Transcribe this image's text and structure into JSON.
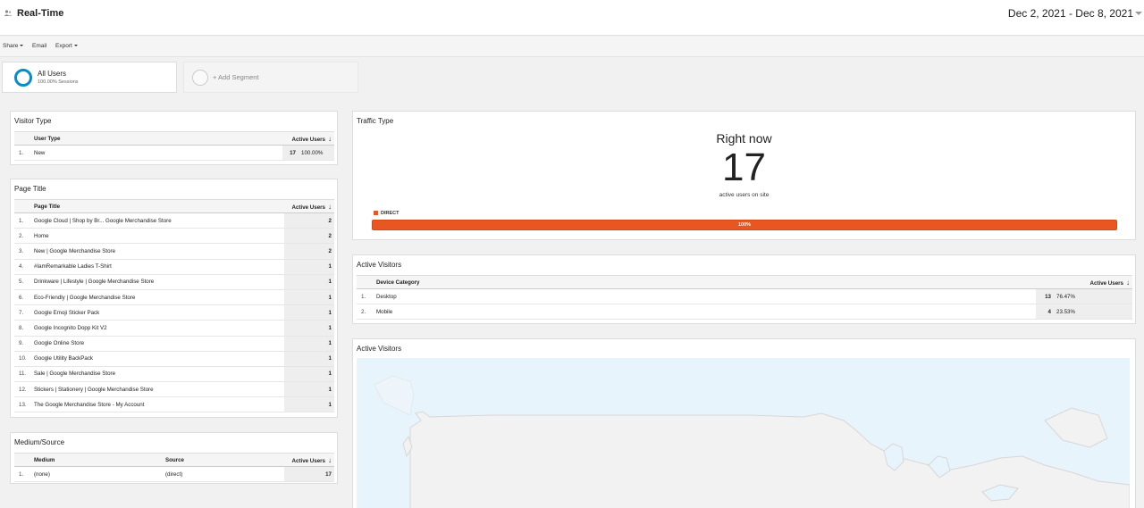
{
  "header": {
    "title": "Real-Time",
    "date_range": "Dec 2, 2021 - Dec 8, 2021"
  },
  "toolbar": {
    "share": "Share",
    "email": "Email",
    "export": "Export"
  },
  "segments": {
    "active": {
      "name": "All Users",
      "sub": "100.00% Sessions"
    },
    "add_label": "+ Add Segment"
  },
  "visitor_type": {
    "title": "Visitor Type",
    "columns": [
      "User Type",
      "Active Users"
    ],
    "rows": [
      {
        "idx": "1.",
        "label": "New",
        "value": "17",
        "pct": "100.00%"
      }
    ]
  },
  "page_title": {
    "title": "Page Title",
    "columns": [
      "Page Title",
      "Active Users"
    ],
    "rows": [
      {
        "idx": "1.",
        "label": "Google Cloud | Shop by Br... Google Merchandise Store",
        "value": "2"
      },
      {
        "idx": "2.",
        "label": "Home",
        "value": "2"
      },
      {
        "idx": "3.",
        "label": "New | Google Merchandise Store",
        "value": "2"
      },
      {
        "idx": "4.",
        "label": "#IamRemarkable Ladies T-Shirt",
        "value": "1"
      },
      {
        "idx": "5.",
        "label": "Drinkware | Lifestyle | Google Merchandise Store",
        "value": "1"
      },
      {
        "idx": "6.",
        "label": "Eco-Friendly | Google Merchandise Store",
        "value": "1"
      },
      {
        "idx": "7.",
        "label": "Google Emoji Sticker Pack",
        "value": "1"
      },
      {
        "idx": "8.",
        "label": "Google Incognito Dopp Kit V2",
        "value": "1"
      },
      {
        "idx": "9.",
        "label": "Google Online Store",
        "value": "1"
      },
      {
        "idx": "10.",
        "label": "Google Utility BackPack",
        "value": "1"
      },
      {
        "idx": "11.",
        "label": "Sale | Google Merchandise Store",
        "value": "1"
      },
      {
        "idx": "12.",
        "label": "Stickers | Stationery | Google Merchandise Store",
        "value": "1"
      },
      {
        "idx": "13.",
        "label": "The Google Merchandise Store - My Account",
        "value": "1"
      }
    ]
  },
  "medium_source": {
    "title": "Medium/Source",
    "columns": [
      "Medium",
      "Source",
      "Active Users"
    ],
    "rows": [
      {
        "idx": "1.",
        "medium": "(none)",
        "source": "(direct)",
        "value": "17"
      }
    ]
  },
  "traffic_type": {
    "title": "Traffic Type",
    "right_now_label": "Right now",
    "count": "17",
    "sub": "active users on site",
    "legend": "DIRECT",
    "bar_label": "100%",
    "bar_fraction": 1.0,
    "bar_color": "#e85622"
  },
  "active_visitors_table": {
    "title": "Active Visitors",
    "columns": [
      "Device Category",
      "Active Users"
    ],
    "rows": [
      {
        "idx": "1.",
        "label": "Desktop",
        "value": "13",
        "pct": "76.47%"
      },
      {
        "idx": "2.",
        "label": "Mobile",
        "value": "4",
        "pct": "23.53%"
      }
    ]
  },
  "active_visitors_map": {
    "title": "Active Visitors"
  },
  "colors": {
    "accent": "#058dc7",
    "direct": "#e85622",
    "map_water": "#e8f4fc",
    "map_land": "#f2f2f2"
  }
}
